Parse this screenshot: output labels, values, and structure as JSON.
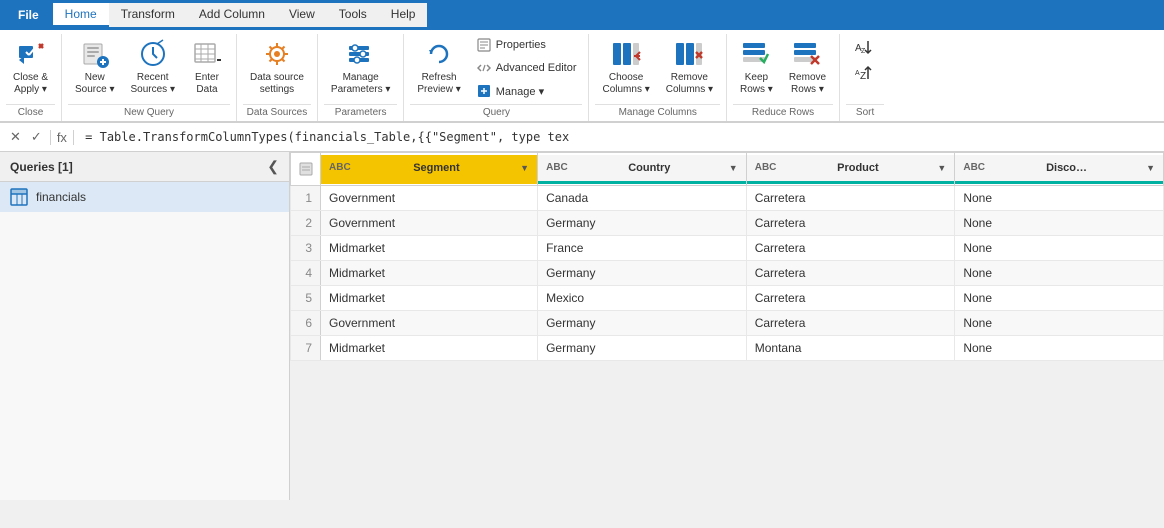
{
  "tabs": {
    "file": "File",
    "home": "Home",
    "transform": "Transform",
    "addColumn": "Add Column",
    "view": "View",
    "tools": "Tools",
    "help": "Help",
    "activeTab": "Home"
  },
  "ribbon": {
    "groups": [
      {
        "name": "close",
        "label": "Close",
        "buttons": [
          {
            "id": "close-apply",
            "label": "Close &\nApply",
            "hasDropdown": true
          }
        ]
      },
      {
        "name": "new-query",
        "label": "New Query",
        "buttons": [
          {
            "id": "new-source",
            "label": "New\nSource",
            "hasDropdown": true
          },
          {
            "id": "recent-sources",
            "label": "Recent\nSources",
            "hasDropdown": true
          },
          {
            "id": "enter-data",
            "label": "Enter\nData",
            "hasDropdown": false
          }
        ]
      },
      {
        "name": "data-sources",
        "label": "Data Sources",
        "buttons": [
          {
            "id": "data-source-settings",
            "label": "Data source\nsettings",
            "hasDropdown": false
          }
        ]
      },
      {
        "name": "parameters",
        "label": "Parameters",
        "buttons": [
          {
            "id": "manage-parameters",
            "label": "Manage\nParameters",
            "hasDropdown": true
          }
        ]
      },
      {
        "name": "query",
        "label": "Query",
        "smallButtons": [
          {
            "id": "properties",
            "label": "Properties"
          },
          {
            "id": "advanced-editor",
            "label": "Advanced Editor"
          },
          {
            "id": "manage",
            "label": "Manage",
            "hasDropdown": true
          }
        ],
        "buttons": [
          {
            "id": "refresh-preview",
            "label": "Refresh\nPreview",
            "hasDropdown": true
          }
        ]
      },
      {
        "name": "manage-columns",
        "label": "Manage Columns",
        "buttons": [
          {
            "id": "choose-columns",
            "label": "Choose\nColumns",
            "hasDropdown": true
          },
          {
            "id": "remove-columns",
            "label": "Remove\nColumns",
            "hasDropdown": true
          }
        ]
      },
      {
        "name": "reduce-rows",
        "label": "Reduce Rows",
        "buttons": [
          {
            "id": "keep-rows",
            "label": "Keep\nRows",
            "hasDropdown": true
          },
          {
            "id": "remove-rows",
            "label": "Remove\nRows",
            "hasDropdown": true
          }
        ]
      },
      {
        "name": "sort",
        "label": "Sort",
        "sortButtons": [
          {
            "id": "sort-asc",
            "label": "A→Z"
          },
          {
            "id": "sort-desc",
            "label": "Z→A"
          }
        ]
      }
    ]
  },
  "sidebar": {
    "header": "Queries [1]",
    "items": [
      {
        "id": "financials",
        "label": "financials",
        "type": "table"
      }
    ]
  },
  "formulaBar": {
    "formula": " = Table.TransformColumnTypes(financials_Table,{{\"Segment\", type tex"
  },
  "grid": {
    "columns": [
      {
        "id": "segment",
        "type": "ABC",
        "label": "Segment",
        "colorClass": "col-segment"
      },
      {
        "id": "country",
        "type": "ABC",
        "label": "Country",
        "colorClass": "col-country"
      },
      {
        "id": "product",
        "type": "ABC",
        "label": "Product",
        "colorClass": "col-product"
      },
      {
        "id": "discount",
        "type": "ABC",
        "label": "Discount Band",
        "colorClass": "col-discount"
      }
    ],
    "rows": [
      {
        "num": 1,
        "segment": "Government",
        "country": "Canada",
        "product": "Carretera",
        "discount": "None"
      },
      {
        "num": 2,
        "segment": "Government",
        "country": "Germany",
        "product": "Carretera",
        "discount": "None"
      },
      {
        "num": 3,
        "segment": "Midmarket",
        "country": "France",
        "product": "Carretera",
        "discount": "None"
      },
      {
        "num": 4,
        "segment": "Midmarket",
        "country": "Germany",
        "product": "Carretera",
        "discount": "None"
      },
      {
        "num": 5,
        "segment": "Midmarket",
        "country": "Mexico",
        "product": "Carretera",
        "discount": "None"
      },
      {
        "num": 6,
        "segment": "Government",
        "country": "Germany",
        "product": "Carretera",
        "discount": "None"
      },
      {
        "num": 7,
        "segment": "Midmarket",
        "country": "Germany",
        "product": "Montana",
        "discount": "None"
      }
    ]
  }
}
